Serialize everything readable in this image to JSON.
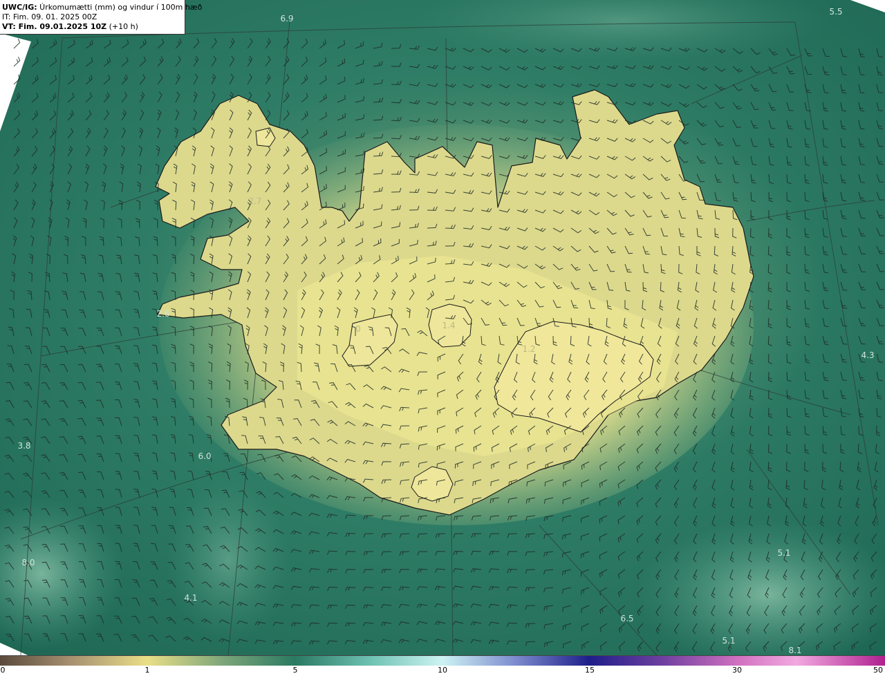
{
  "info": {
    "line1_bold": "UWC/IG:",
    "line1_rest": " Úrkomumætti (mm) og vindur í 100m hæð",
    "line2": "IT: Fim. 09. 01. 2025 00Z",
    "line3_bold": "VT: Fim. 09.01.2025 10Z",
    "line3_rest": " (+10 h)"
  },
  "value_labels": [
    {
      "text": "6.9"
    },
    {
      "text": "5.5"
    },
    {
      "text": "2.7"
    },
    {
      "text": "2.6"
    },
    {
      "text": "0"
    },
    {
      "text": "1.4"
    },
    {
      "text": "1.2"
    },
    {
      "text": "4.3"
    },
    {
      "text": "3.8"
    },
    {
      "text": "6.0"
    },
    {
      "text": "8.0"
    },
    {
      "text": "4.1"
    },
    {
      "text": "5.1"
    },
    {
      "text": "6.5"
    },
    {
      "text": "5.1"
    },
    {
      "text": "8.1"
    }
  ],
  "colorbar": {
    "ticks": [
      "0",
      "1",
      "5",
      "10",
      "15",
      "30",
      "50"
    ],
    "tick_values": [
      0,
      1,
      5,
      10,
      15,
      30,
      50
    ]
  },
  "colors": {
    "sea_dark": "#1f6d5a",
    "sea_mid": "#3a8a6f",
    "land_light": "#e3df8c",
    "land_mid": "#b9c682",
    "coast": "#1a1a1a"
  }
}
